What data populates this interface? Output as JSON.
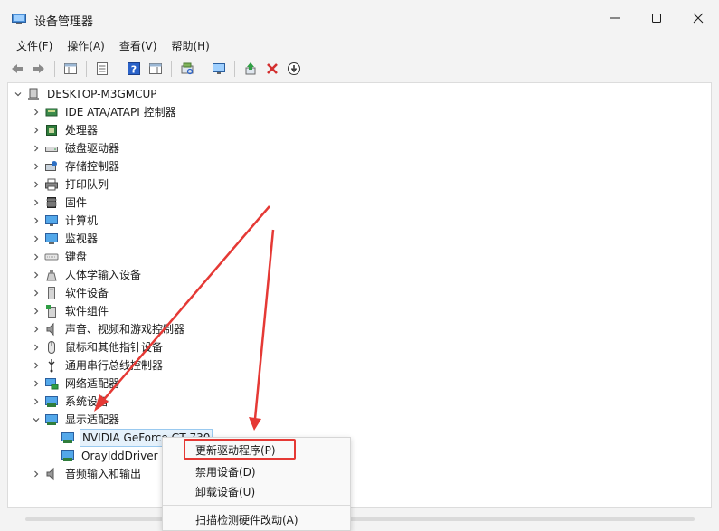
{
  "window": {
    "title": "设备管理器",
    "controls": [
      "minimize",
      "maximize",
      "close"
    ]
  },
  "menu": [
    "文件(F)",
    "操作(A)",
    "查看(V)",
    "帮助(H)"
  ],
  "toolbar": [
    "back-icon",
    "forward-icon",
    "console-tree-icon",
    "properties-icon",
    "help-icon",
    "action-pane-icon",
    "scan-hardware-icon",
    "monitor-icon",
    "update-driver-icon",
    "uninstall-icon",
    "disable-device-icon"
  ],
  "tree": {
    "root": "DESKTOP-M3GMCUP",
    "categories": [
      {
        "label": "IDE ATA/ATAPI 控制器",
        "icon": "ide-controller-icon",
        "expanded": false
      },
      {
        "label": "处理器",
        "icon": "processor-icon",
        "expanded": false
      },
      {
        "label": "磁盘驱动器",
        "icon": "disk-drive-icon",
        "expanded": false
      },
      {
        "label": "存储控制器",
        "icon": "storage-controller-icon",
        "expanded": false
      },
      {
        "label": "打印队列",
        "icon": "printer-icon",
        "expanded": false
      },
      {
        "label": "固件",
        "icon": "firmware-icon",
        "expanded": false
      },
      {
        "label": "计算机",
        "icon": "computer-icon",
        "expanded": false
      },
      {
        "label": "监视器",
        "icon": "monitor-icon",
        "expanded": false
      },
      {
        "label": "键盘",
        "icon": "keyboard-icon",
        "expanded": false
      },
      {
        "label": "人体学输入设备",
        "icon": "hid-icon",
        "expanded": false
      },
      {
        "label": "软件设备",
        "icon": "software-device-icon",
        "expanded": false
      },
      {
        "label": "软件组件",
        "icon": "software-component-icon",
        "expanded": false
      },
      {
        "label": "声音、视频和游戏控制器",
        "icon": "speaker-icon",
        "expanded": false
      },
      {
        "label": "鼠标和其他指针设备",
        "icon": "mouse-icon",
        "expanded": false
      },
      {
        "label": "通用串行总线控制器",
        "icon": "usb-icon",
        "expanded": false
      },
      {
        "label": "网络适配器",
        "icon": "network-adapter-icon",
        "expanded": false
      },
      {
        "label": "系统设备",
        "icon": "system-device-icon",
        "expanded": false
      },
      {
        "label": "显示适配器",
        "icon": "display-adapter-icon",
        "expanded": true,
        "children": [
          {
            "label": "NVIDIA GeForce GT 730",
            "icon": "display-adapter-icon",
            "selected": true
          },
          {
            "label": "OrayIddDriver",
            "icon": "display-adapter-icon",
            "selected": false
          }
        ]
      },
      {
        "label": "音频输入和输出",
        "icon": "audio-io-icon",
        "expanded": false
      }
    ]
  },
  "context_menu": {
    "items": [
      "更新驱动程序(P)",
      "禁用设备(D)",
      "卸载设备(U)",
      "扫描检测硬件改动(A)"
    ],
    "highlighted": "更新驱动程序(P)"
  },
  "colors": {
    "accent": "#0078d4",
    "annotation": "#e53935",
    "selection": "#e5f1fb"
  }
}
